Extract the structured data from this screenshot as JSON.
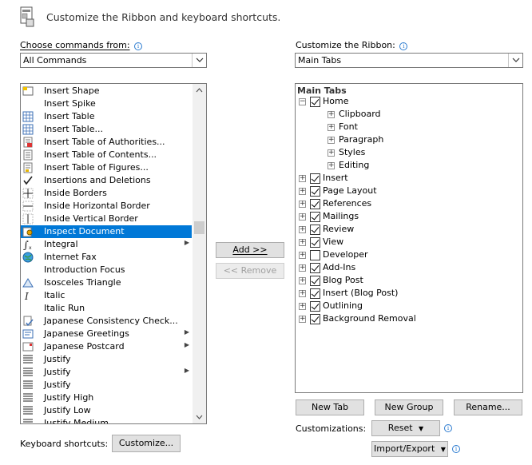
{
  "header": {
    "title": "Customize the Ribbon and keyboard shortcuts."
  },
  "left": {
    "choose_label": "Choose commands from:",
    "choose_value": "All Commands",
    "items": [
      {
        "label": "Insert Shape",
        "icon": "shape-icon"
      },
      {
        "label": "Insert Spike",
        "icon": ""
      },
      {
        "label": "Insert Table",
        "icon": "table-icon"
      },
      {
        "label": "Insert Table...",
        "icon": "table-icon"
      },
      {
        "label": "Insert Table of Authorities...",
        "icon": "authorities-icon"
      },
      {
        "label": "Insert Table of Contents...",
        "icon": "contents-icon"
      },
      {
        "label": "Insert Table of Figures...",
        "icon": "figures-icon"
      },
      {
        "label": "Insertions and Deletions",
        "icon": "checkmark-icon"
      },
      {
        "label": "Inside Borders",
        "icon": "inside-borders-icon"
      },
      {
        "label": "Inside Horizontal Border",
        "icon": "horizontal-border-icon"
      },
      {
        "label": "Inside Vertical Border",
        "icon": "vertical-border-icon"
      },
      {
        "label": "Inspect Document",
        "icon": "inspect-icon",
        "selected": true
      },
      {
        "label": "Integral",
        "icon": "integral-icon",
        "submenu": true
      },
      {
        "label": "Internet Fax",
        "icon": "globe-icon"
      },
      {
        "label": "Introduction Focus",
        "icon": ""
      },
      {
        "label": "Isosceles Triangle",
        "icon": "triangle-icon"
      },
      {
        "label": "Italic",
        "icon": "italic-icon"
      },
      {
        "label": "Italic Run",
        "icon": ""
      },
      {
        "label": "Japanese Consistency Check...",
        "icon": "consistency-icon"
      },
      {
        "label": "Japanese Greetings",
        "icon": "greetings-icon",
        "submenu": true
      },
      {
        "label": "Japanese Postcard",
        "icon": "postcard-icon",
        "submenu": true
      },
      {
        "label": "Justify",
        "icon": "justify-icon"
      },
      {
        "label": "Justify",
        "icon": "justify-icon",
        "submenu": true
      },
      {
        "label": "Justify",
        "icon": "justify-icon"
      },
      {
        "label": "Justify High",
        "icon": "justify-icon"
      },
      {
        "label": "Justify Low",
        "icon": "justify-icon"
      },
      {
        "label": "Justify Medium",
        "icon": "justify-icon"
      }
    ]
  },
  "middle": {
    "add_label": "Add >>",
    "remove_label": "<< Remove"
  },
  "right": {
    "customize_label": "Customize the Ribbon:",
    "customize_value": "Main Tabs",
    "tree_header": "Main Tabs",
    "tree": [
      {
        "label": "Home",
        "level": 0,
        "expander": "−",
        "checked": true
      },
      {
        "label": "Clipboard",
        "level": 1,
        "expander": "+"
      },
      {
        "label": "Font",
        "level": 1,
        "expander": "+"
      },
      {
        "label": "Paragraph",
        "level": 1,
        "expander": "+"
      },
      {
        "label": "Styles",
        "level": 1,
        "expander": "+"
      },
      {
        "label": "Editing",
        "level": 1,
        "expander": "+"
      },
      {
        "label": "Insert",
        "level": 0,
        "expander": "+",
        "checked": true
      },
      {
        "label": "Page Layout",
        "level": 0,
        "expander": "+",
        "checked": true
      },
      {
        "label": "References",
        "level": 0,
        "expander": "+",
        "checked": true
      },
      {
        "label": "Mailings",
        "level": 0,
        "expander": "+",
        "checked": true
      },
      {
        "label": "Review",
        "level": 0,
        "expander": "+",
        "checked": true
      },
      {
        "label": "View",
        "level": 0,
        "expander": "+",
        "checked": true
      },
      {
        "label": "Developer",
        "level": 0,
        "expander": "+",
        "checked": false
      },
      {
        "label": "Add-Ins",
        "level": 0,
        "expander": "+",
        "checked": true
      },
      {
        "label": "Blog Post",
        "level": 0,
        "expander": "+",
        "checked": true
      },
      {
        "label": "Insert (Blog Post)",
        "level": 0,
        "expander": "+",
        "checked": true
      },
      {
        "label": "Outlining",
        "level": 0,
        "expander": "+",
        "checked": true
      },
      {
        "label": "Background Removal",
        "level": 0,
        "expander": "+",
        "checked": true
      }
    ],
    "new_tab": "New Tab",
    "new_group": "New Group",
    "rename": "Rename...",
    "customizations_label": "Customizations:",
    "reset": "Reset",
    "import_export": "Import/Export"
  },
  "bottom": {
    "keyboard_label": "Keyboard shortcuts:",
    "customize_button": "Customize..."
  },
  "colors": {
    "selection": "#0078d7",
    "info": "#2b7bd0"
  }
}
